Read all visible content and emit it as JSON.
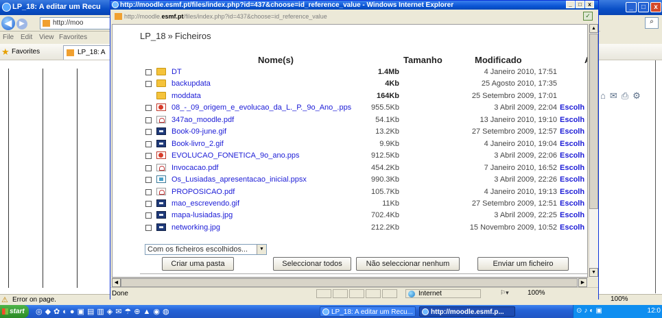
{
  "background_window": {
    "title": "LP_18: A editar um Recu",
    "address": "http://moo",
    "menu": [
      "File",
      "Edit",
      "View",
      "Favorites"
    ],
    "favorites_label": "Favorites",
    "tab_label": "LP_18: A",
    "status_text": "Error on page.",
    "status_zoom": "100%"
  },
  "popup": {
    "title": "http://moodle.esmf.pt/files/index.php?id=437&choose=id_reference_value - Windows Internet Explorer",
    "address_prefix": "http://moodle.",
    "address_domain": "esmf.pt",
    "address_suffix": "/files/index.php?id=437&choose=id_reference_value",
    "status_done": "Done",
    "status_zone": "Internet",
    "status_zoom": "100%"
  },
  "breadcrumb": {
    "course": "LP_18",
    "separator": "»",
    "current": "Ficheiros"
  },
  "table": {
    "headers": {
      "name": "Nome(s)",
      "size": "Tamanho",
      "modified": "Modificado",
      "action": "A"
    },
    "rows": [
      {
        "name": "DT",
        "icon": "folder-icon",
        "size": "1.4Mb",
        "size_bold": true,
        "modified": "4 Janeiro 2010, 17:51",
        "choose": "",
        "checkbox": true
      },
      {
        "name": "backupdata",
        "icon": "folder-icon",
        "size": "4Kb",
        "size_bold": true,
        "modified": "25 Agosto 2010, 17:35",
        "choose": "",
        "checkbox": true
      },
      {
        "name": "moddata",
        "icon": "folder-icon",
        "size": "164Kb",
        "size_bold": true,
        "modified": "25 Setembro 2009, 17:01",
        "choose": "",
        "checkbox": false
      },
      {
        "name": "08_-_09_origem_e_evolucao_da_L._P._9o_Ano_.pps",
        "icon": "ppt-icon",
        "size": "955.5Kb",
        "size_bold": false,
        "modified": "3 Abril 2009, 22:04",
        "choose": "Escolh",
        "checkbox": true
      },
      {
        "name": "347ao_moodle.pdf",
        "icon": "pdf-icon",
        "size": "54.1Kb",
        "size_bold": false,
        "modified": "13 Janeiro 2010, 19:10",
        "choose": "Escolh",
        "checkbox": true
      },
      {
        "name": "Book-09-june.gif",
        "icon": "image-icon",
        "size": "13.2Kb",
        "size_bold": false,
        "modified": "27 Setembro 2009, 12:57",
        "choose": "Escolh",
        "checkbox": true
      },
      {
        "name": "Book-livro_2.gif",
        "icon": "image-icon",
        "size": "9.9Kb",
        "size_bold": false,
        "modified": "4 Janeiro 2010, 19:04",
        "choose": "Escolh",
        "checkbox": true
      },
      {
        "name": "EVOLUCAO_FONETICA_9o_ano.pps",
        "icon": "ppt-icon",
        "size": "912.5Kb",
        "size_bold": false,
        "modified": "3 Abril 2009, 22:06",
        "choose": "Escolh",
        "checkbox": true
      },
      {
        "name": "Invocacao.pdf",
        "icon": "pdf-icon",
        "size": "454.2Kb",
        "size_bold": false,
        "modified": "7 Janeiro 2010, 16:52",
        "choose": "Escolh",
        "checkbox": true
      },
      {
        "name": "Os_Lusiadas_apresentacao_inicial.ppsx",
        "icon": "ppsx-icon",
        "size": "990.3Kb",
        "size_bold": false,
        "modified": "3 Abril 2009, 22:26",
        "choose": "Escolh",
        "checkbox": true
      },
      {
        "name": "PROPOSICAO.pdf",
        "icon": "pdf-icon",
        "size": "105.7Kb",
        "size_bold": false,
        "modified": "4 Janeiro 2010, 19:13",
        "choose": "Escolh",
        "checkbox": true
      },
      {
        "name": "mao_escrevendo.gif",
        "icon": "image-icon",
        "size": "11Kb",
        "size_bold": false,
        "modified": "27 Setembro 2009, 12:51",
        "choose": "Escolh",
        "checkbox": true
      },
      {
        "name": "mapa-lusiadas.jpg",
        "icon": "image-icon",
        "size": "702.4Kb",
        "size_bold": false,
        "modified": "3 Abril 2009, 22:25",
        "choose": "Escolh",
        "checkbox": true
      },
      {
        "name": "networking.jpg",
        "icon": "image-icon",
        "size": "212.2Kb",
        "size_bold": false,
        "modified": "15 Novembro 2009, 10:52",
        "choose": "Escolh",
        "checkbox": true
      }
    ]
  },
  "actions": {
    "with_selected": "Com os ficheiros escolhidos...",
    "create_folder": "Criar uma pasta",
    "select_all": "Seleccionar todos",
    "select_none": "Não seleccionar nenhum",
    "upload": "Enviar um ficheiro"
  },
  "taskbar": {
    "start": "start",
    "task1": "LP_18: A editar um Recu...",
    "task2": "http://moodle.esmf.p...",
    "clock": "12:0"
  },
  "colors": {
    "link": "#1b1bd6",
    "titlebar": "#0a55d5",
    "folder": "#f5c33b"
  }
}
